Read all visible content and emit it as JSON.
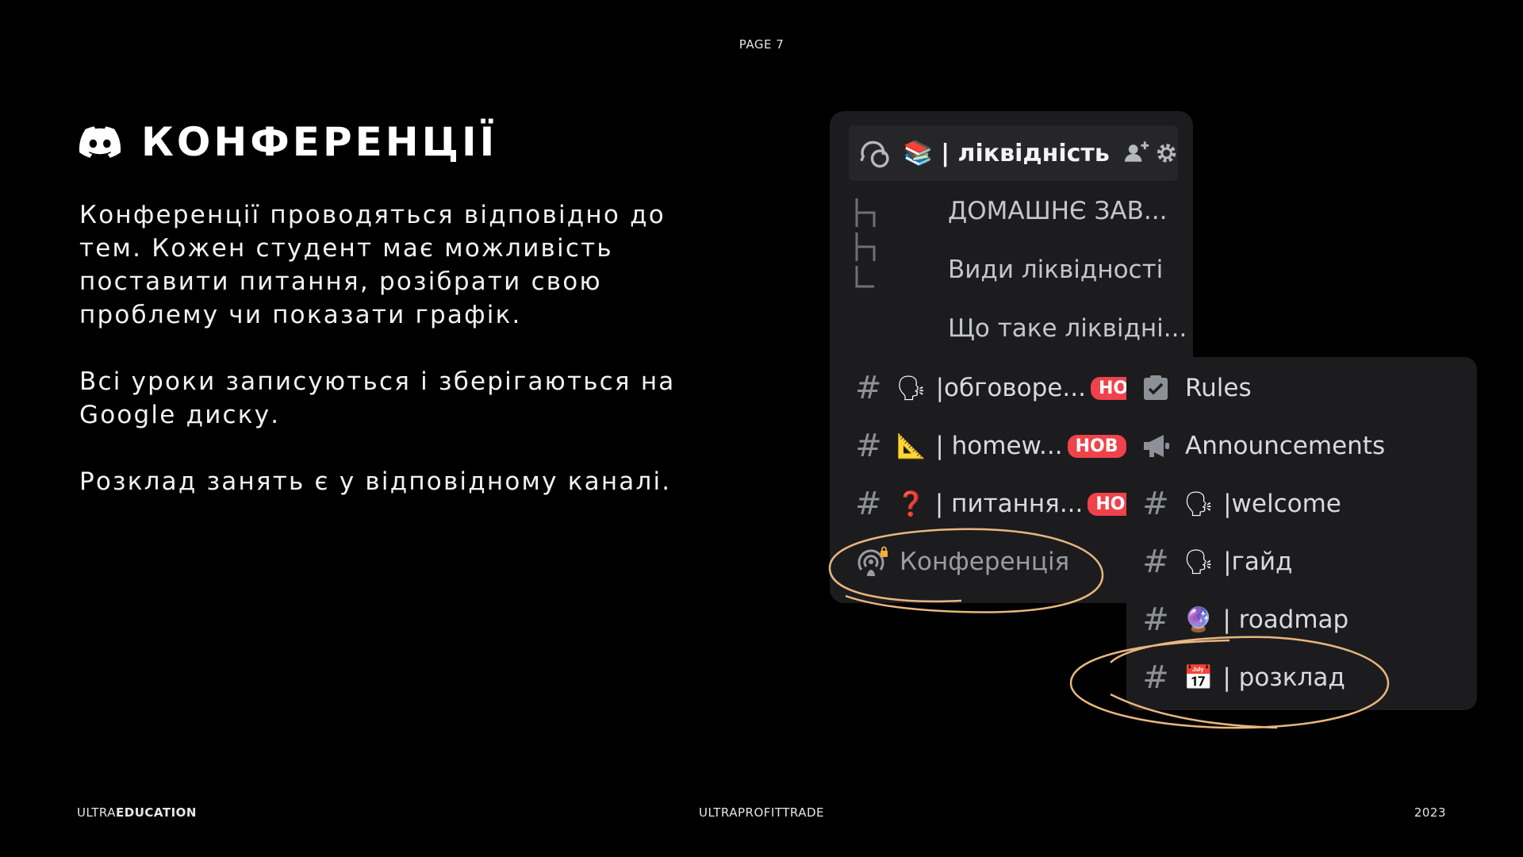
{
  "page_label": "PAGE 7",
  "title": "КОНФЕРЕНЦІЇ",
  "paragraphs": [
    "Конференції проводяться відповідно до тем. Кожен студент має можливість поставити питання, розібрати свою проблему чи показати графік.",
    "Всі уроки записуються і зберігаються на Google диску.",
    "Розклад занять є у відповідному каналі."
  ],
  "footer": {
    "left_light": "ULTRA",
    "left_bold": "EDUCATION",
    "center": "ULTRAPROFITTRADE",
    "right": "2023"
  },
  "discord": {
    "header_channel": "| ліквідність",
    "threads": [
      "ДОМАШНЄ ЗАВ...",
      "Види ліквідності",
      "Що таке ліквідні..."
    ],
    "channels": [
      {
        "emoji": "🗣",
        "name": "|обговоре...",
        "badge": "НОВ"
      },
      {
        "emoji": "📐",
        "name": " | homew...",
        "badge": "НОВ"
      },
      {
        "emoji": "❓",
        "name": " | питання...",
        "badge": "НОВ"
      }
    ],
    "voice_channel": "Конференція",
    "server_channels": [
      {
        "type": "rules",
        "name": "Rules"
      },
      {
        "type": "announce",
        "name": "Announcements"
      },
      {
        "type": "text",
        "emoji": "🗣",
        "name": "|welcome"
      },
      {
        "type": "text",
        "emoji": "🗣",
        "name": "|гайд"
      },
      {
        "type": "text",
        "emoji": "🔮",
        "name": " | roadmap"
      },
      {
        "type": "text",
        "emoji": "📅",
        "name": " | розклад"
      }
    ],
    "colors": {
      "panel": "#1c1c1e",
      "badge": "#f0424a",
      "highlight": "#e8b77e"
    }
  }
}
